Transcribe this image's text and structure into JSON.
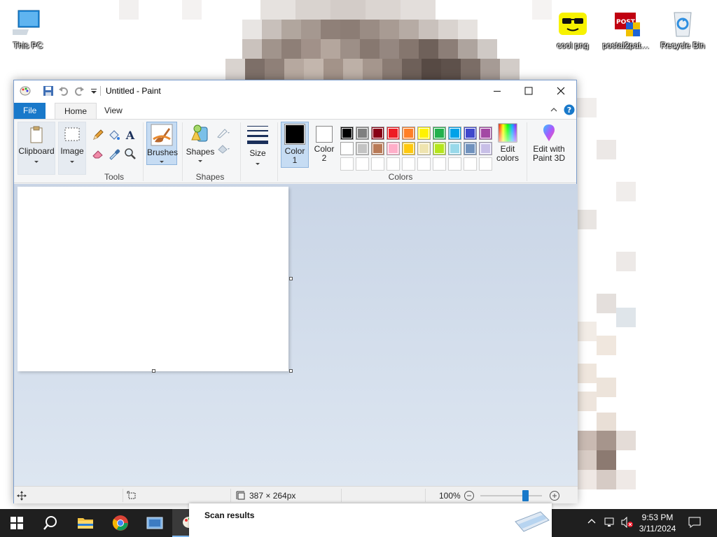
{
  "desktop": {
    "icons": [
      {
        "label": "This PC",
        "icon": "this-pc-icon"
      },
      {
        "label": "cool png",
        "icon": "sunglasses-smiley-icon"
      },
      {
        "label": "postal2pate...",
        "icon": "postal-game-icon"
      },
      {
        "label": "Recycle Bin",
        "icon": "recycle-bin-icon"
      }
    ]
  },
  "paint": {
    "title": "Untitled - Paint",
    "tabs": {
      "file": "File",
      "home": "Home",
      "view": "View"
    },
    "ribbon": {
      "clipboard": "Clipboard",
      "image": "Image",
      "tools_label": "Tools",
      "brushes": "Brushes",
      "shapes": "Shapes",
      "shapes_label": "Shapes",
      "size": "Size",
      "color1_a": "Color",
      "color1_b": "1",
      "color2_a": "Color",
      "color2_b": "2",
      "colors_label": "Colors",
      "edit_colors_a": "Edit",
      "edit_colors_b": "colors",
      "paint3d_a": "Edit with",
      "paint3d_b": "Paint 3D"
    },
    "colors": {
      "color1": "#000000",
      "color2": "#ffffff",
      "palette_row1": [
        "#000000",
        "#7f7f7f",
        "#880015",
        "#ed1c24",
        "#ff7f27",
        "#fff200",
        "#22b14c",
        "#00a2e8",
        "#3f48cc",
        "#a349a4"
      ],
      "palette_row2": [
        "#ffffff",
        "#c3c3c3",
        "#b97a57",
        "#ffaec9",
        "#ffc90e",
        "#efe4b0",
        "#b5e61d",
        "#99d9ea",
        "#7092be",
        "#c8bfe7"
      ],
      "accent": "#1979ca"
    },
    "status": {
      "image_size": "387 × 264px",
      "zoom": "100%",
      "zoom_level_fraction": 0.5
    }
  },
  "taskbar": {
    "popup_title": "Scan results",
    "time": "9:53 PM",
    "date": "3/11/2024"
  }
}
